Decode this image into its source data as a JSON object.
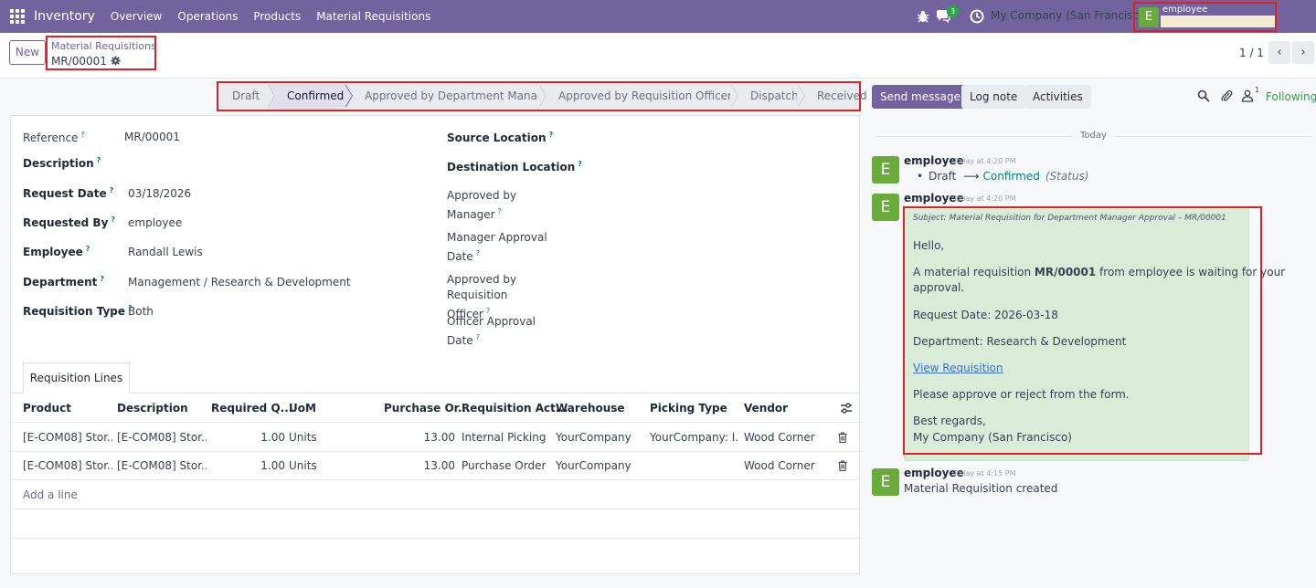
{
  "navbar": {
    "app_name": "Inventory",
    "menu": [
      "Overview",
      "Operations",
      "Products",
      "Material Requisitions"
    ],
    "chat_badge": "3",
    "company": "My Company (San Francisco)",
    "user_initial": "E",
    "user_name": "employee"
  },
  "control_panel": {
    "new_label": "New",
    "breadcrumb_parent": "Material Requisitions",
    "breadcrumb_current": "MR/00001",
    "pager": "1 / 1",
    "prev": "‹",
    "next": "›"
  },
  "statusbar": {
    "stages": [
      "Draft",
      "Confirmed",
      "Approved by Department Manager",
      "Approved by Requisition Officer",
      "Dispatch",
      "Received"
    ],
    "active": "Confirmed"
  },
  "form": {
    "reference_label": "Reference",
    "reference": "MR/00001",
    "description_label": "Description",
    "request_date_label": "Request Date",
    "request_date": "03/18/2026",
    "requested_by_label": "Requested By",
    "requested_by": "employee",
    "employee_label": "Employee",
    "employee": "Randall Lewis",
    "department_label": "Department",
    "department": "Management / Research & Development",
    "requisition_type_label": "Requisition Type",
    "requisition_type": "Both",
    "source_location_label": "Source Location",
    "destination_location_label": "Destination Location",
    "approved_by_manager_label": "Approved by Manager",
    "manager_approval_date_label": "Manager Approval Date",
    "approved_by_officer_label": "Approved by Requisition Officer",
    "officer_approval_date_label": "Officer Approval Date",
    "help_mark": "?"
  },
  "lines": {
    "tab": "Requisition Lines",
    "columns": [
      "Product",
      "Description",
      "Required Q...",
      "UoM",
      "Purchase Or...",
      "Requisition Act...",
      "Warehouse",
      "Picking Type",
      "Vendor"
    ],
    "rows": [
      {
        "product": "[E-COM08] Stor...",
        "description": "[E-COM08] Stor...",
        "qty": "1.00",
        "uom": "Units",
        "purchase": "13.00",
        "action": "Internal Picking",
        "warehouse": "YourCompany",
        "picking": "YourCompany: I...",
        "vendor": "Wood Corner"
      },
      {
        "product": "[E-COM08] Stor...",
        "description": "[E-COM08] Stor...",
        "qty": "1.00",
        "uom": "Units",
        "purchase": "13.00",
        "action": "Purchase Order",
        "warehouse": "YourCompany",
        "picking": "",
        "vendor": "Wood Corner"
      }
    ],
    "add_line": "Add a line"
  },
  "chatter": {
    "send_message": "Send message",
    "log_note": "Log note",
    "activities": "Activities",
    "followers_count": "1",
    "following": "Following",
    "today": "Today",
    "messages": [
      {
        "initial": "E",
        "author": "employee",
        "time": "Today at 4:20 PM",
        "old_value": "Draft",
        "new_value": "Confirmed",
        "field": "(Status)"
      },
      {
        "initial": "E",
        "author": "employee",
        "time": "Today at 4:20 PM",
        "subject": "Subject: Material Requisition for Department Manager Approval – MR/00001",
        "hello": "Hello,",
        "line1_pre": "A material requisition ",
        "line1_ref": "MR/00001",
        "line1_post": " from employee is waiting for your",
        "line1_cont": "approval.",
        "request_date": "Request Date: 2026-03-18",
        "department": "Department: Research & Development",
        "link": "View Requisition",
        "approve": "Please approve or reject from the form.",
        "regards": "Best regards,",
        "signature": "My Company (San Francisco)"
      },
      {
        "initial": "E",
        "author": "employee",
        "time": "Today at 4:15 PM",
        "body": "Material Requisition created"
      }
    ]
  }
}
